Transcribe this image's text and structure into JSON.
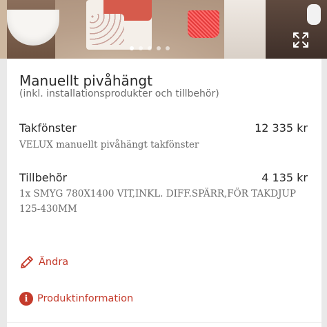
{
  "product": {
    "title": "Manuellt pivåhängt",
    "subtitle": "(inkl. installationsprodukter och tillbehör)"
  },
  "items": [
    {
      "label": "Takfönster",
      "price": "12 335 kr",
      "description": "VELUX manuellt pivåhängt takfönster"
    },
    {
      "label": "Tillbehör",
      "price": "4 135 kr",
      "description": "1x SMYG 780X1400 VIT,INKL. DIFF.SPÄRR,FÖR TAKDJUP 125-430MM"
    }
  ],
  "actions": {
    "edit_label": "Ändra",
    "info_label": "Produktinformation"
  },
  "gallery": {
    "slide_count": 5,
    "active_slide": 1,
    "expand_icon": "expand-icon"
  },
  "colors": {
    "accent": "#c43a2b",
    "text": "#2b2b2b",
    "muted": "#6b6b6b"
  }
}
